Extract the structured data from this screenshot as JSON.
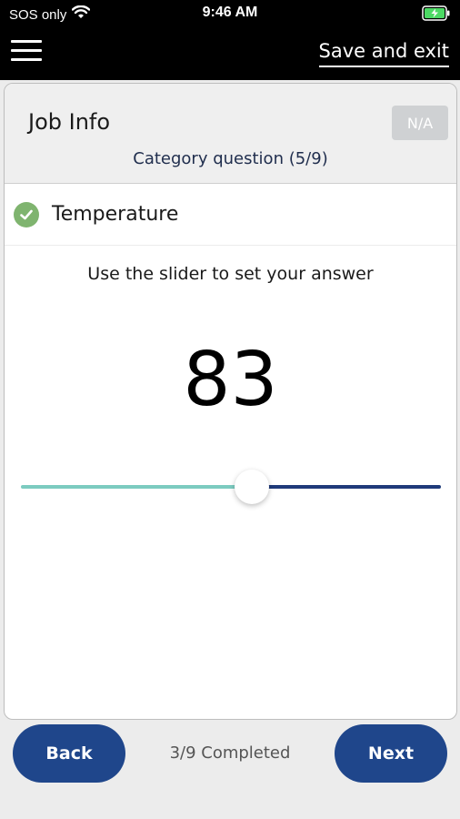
{
  "status_bar": {
    "carrier": "SOS only",
    "time": "9:46 AM"
  },
  "header": {
    "save_exit_label": "Save and exit"
  },
  "card": {
    "title": "Job Info",
    "na_label": "N/A",
    "category": "Category question (5/9)",
    "question": "Temperature",
    "instruction": "Use the slider to set your answer",
    "value": "83",
    "slider_fraction": 0.55
  },
  "footer": {
    "back_label": "Back",
    "next_label": "Next",
    "progress": "3/9 Completed"
  },
  "colors": {
    "primary": "#1f468b",
    "slider_fill": "#7ccbc0",
    "slider_rest": "#1f3a7a",
    "check": "#7fb46f",
    "na_disabled": "#cfd1d3"
  }
}
